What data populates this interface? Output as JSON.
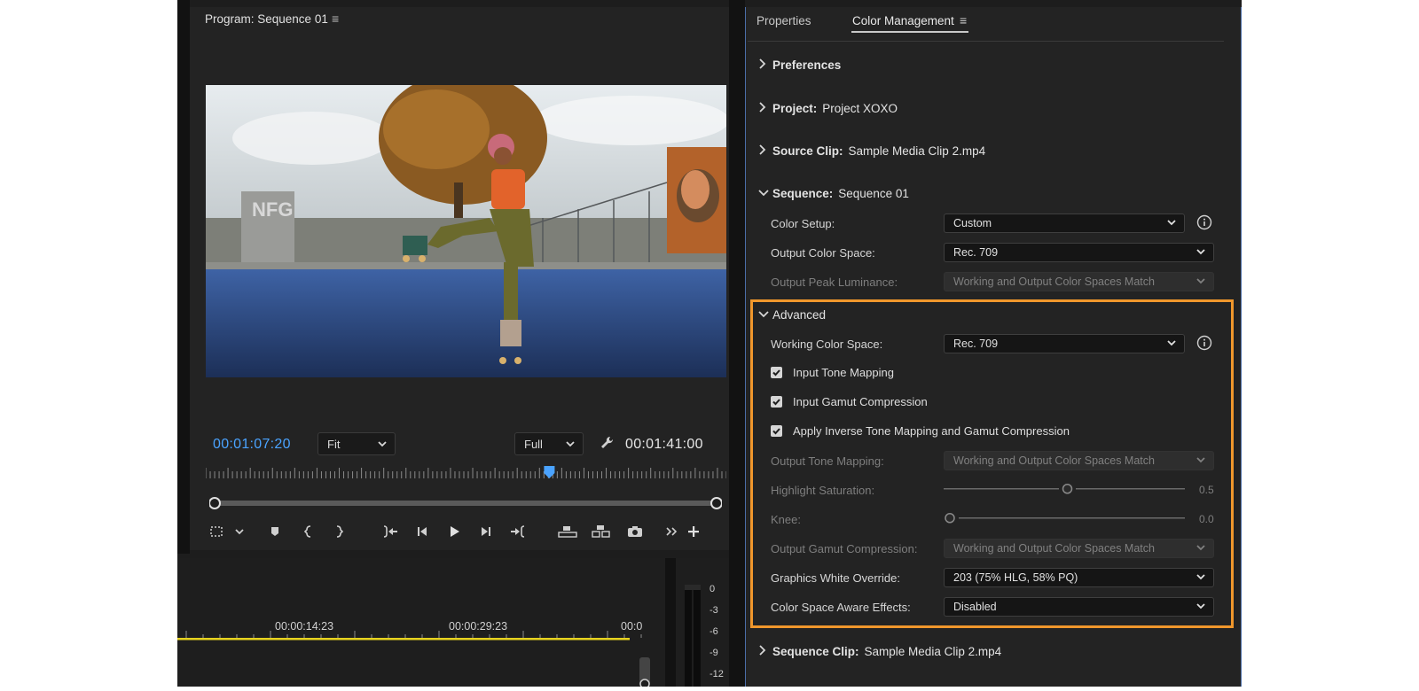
{
  "program_monitor": {
    "title": "Program: Sequence 01",
    "current_timecode": "00:01:07:20",
    "duration_timecode": "00:01:41:00",
    "zoom": "Fit",
    "resolution": "Full",
    "playhead_position_fraction": 0.66
  },
  "timeline": {
    "ruler_times": [
      "00:00:14:23",
      "00:00:29:23",
      "00:0"
    ],
    "meter_scale": [
      "0",
      "-3",
      "-6",
      "-9",
      "-12"
    ]
  },
  "color_panel": {
    "tabs": {
      "properties": "Properties",
      "color_management": "Color Management"
    },
    "preferences": {
      "label": "Preferences"
    },
    "project": {
      "label": "Project:",
      "value": "Project XOXO"
    },
    "source_clip": {
      "label": "Source Clip:",
      "value": "Sample Media Clip 2.mp4"
    },
    "sequence": {
      "label": "Sequence:",
      "value": "Sequence 01",
      "color_setup": {
        "label": "Color Setup:",
        "value": "Custom"
      },
      "output_color_space": {
        "label": "Output Color Space:",
        "value": "Rec. 709"
      },
      "output_peak_luminance": {
        "label": "Output Peak Luminance:",
        "value": "Working and Output Color Spaces Match"
      }
    },
    "advanced": {
      "label": "Advanced",
      "working_color_space": {
        "label": "Working Color Space:",
        "value": "Rec. 709"
      },
      "input_tone_mapping": {
        "label": "Input Tone Mapping",
        "checked": true
      },
      "input_gamut_compression": {
        "label": "Input Gamut Compression",
        "checked": true
      },
      "apply_inverse": {
        "label": "Apply Inverse Tone Mapping and Gamut Compression",
        "checked": true
      },
      "output_tone_mapping": {
        "label": "Output Tone Mapping:",
        "value": "Working and Output Color Spaces Match"
      },
      "highlight_saturation": {
        "label": "Highlight Saturation:",
        "value": "0.5"
      },
      "knee": {
        "label": "Knee:",
        "value": "0.0"
      },
      "output_gamut_compression": {
        "label": "Output Gamut Compression:",
        "value": "Working and Output Color Spaces Match"
      },
      "graphics_white_override": {
        "label": "Graphics White Override:",
        "value": "203 (75% HLG, 58% PQ)"
      },
      "color_space_aware_effects": {
        "label": "Color Space Aware Effects:",
        "value": "Disabled"
      }
    },
    "sequence_clip": {
      "label": "Sequence Clip:",
      "value": "Sample Media Clip 2.mp4"
    }
  },
  "colors": {
    "accent_timecode": "#4aa3ff",
    "highlight_box": "#f0972c",
    "timeline_playhead_line": "#e6d21f",
    "panel_bg": "#232323"
  }
}
